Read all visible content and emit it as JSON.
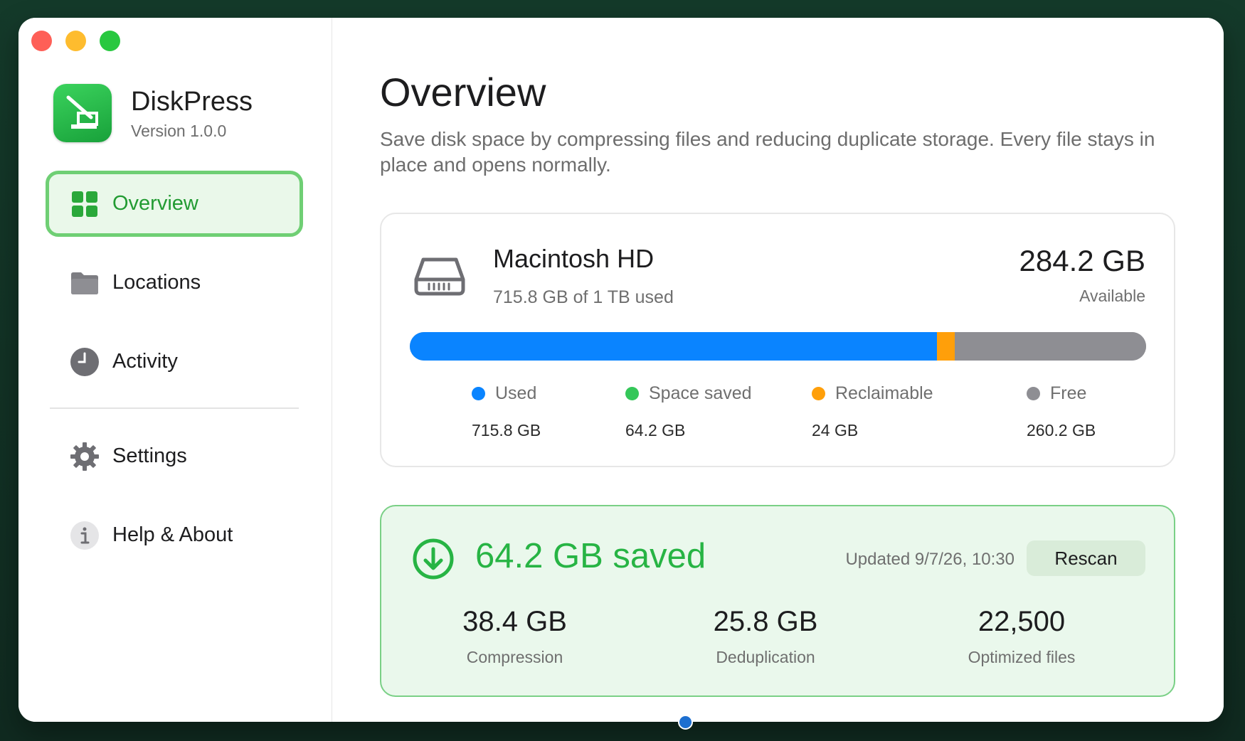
{
  "app": {
    "name": "DiskPress",
    "version": "Version 1.0.0"
  },
  "sidebar": {
    "items": [
      {
        "label": "Overview",
        "icon": "grid-icon",
        "active": true
      },
      {
        "label": "Locations",
        "icon": "folder-icon",
        "active": false
      },
      {
        "label": "Activity",
        "icon": "clock-icon",
        "active": false
      },
      {
        "label": "Settings",
        "icon": "gear-icon",
        "active": false
      },
      {
        "label": "Help & About",
        "icon": "info-icon",
        "active": false
      }
    ]
  },
  "main": {
    "title": "Overview",
    "subtitle": "Save disk space by compressing files and reducing duplicate storage. Every file stays in place and opens normally."
  },
  "disk": {
    "name": "Macintosh HD",
    "used_text": "715.8 GB of 1 TB used",
    "available_value": "284.2 GB",
    "available_label": "Available",
    "bar": {
      "used_fraction": 0.716,
      "saved_fraction": 0.0,
      "reclaimable_fraction": 0.024,
      "free_fraction": 0.26
    },
    "legend": [
      {
        "label": "Used",
        "value": "715.8 GB",
        "color": "#0a84ff"
      },
      {
        "label": "Space saved",
        "value": "64.2 GB",
        "color": "#34c759"
      },
      {
        "label": "Reclaimable",
        "value": "24 GB",
        "color": "#ff9f0a"
      },
      {
        "label": "Free",
        "value": "260.2 GB",
        "color": "#8e8e93"
      }
    ]
  },
  "savings": {
    "title": "64.2 GB saved",
    "updated": "Updated 9/7/26, 10:30",
    "rescan_label": "Rescan",
    "stats": [
      {
        "value": "38.4 GB",
        "label": "Compression"
      },
      {
        "value": "25.8 GB",
        "label": "Deduplication"
      },
      {
        "value": "22,500",
        "label": "Optimized files"
      }
    ]
  },
  "colors": {
    "accent": "#34c759",
    "blue": "#0a84ff",
    "orange": "#ff9f0a",
    "gray": "#8e8e93"
  }
}
